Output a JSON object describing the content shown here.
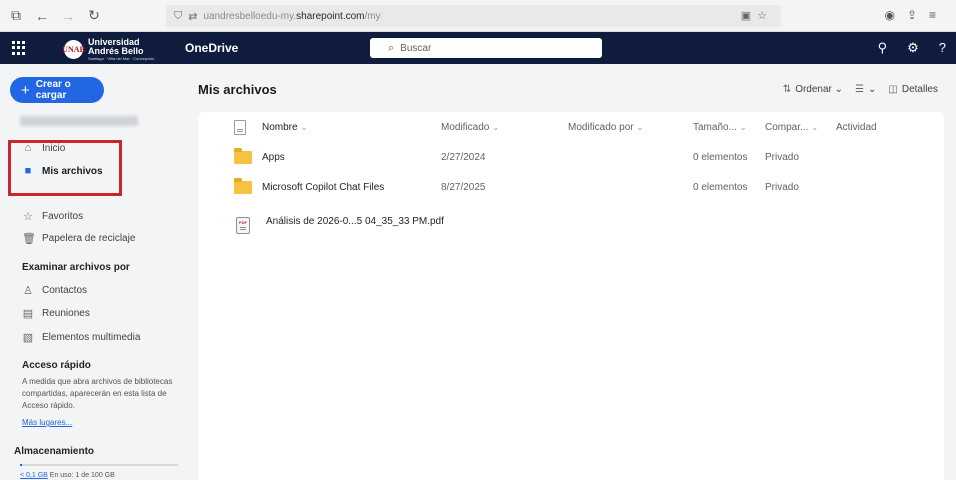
{
  "browser": {
    "nav_icons": [
      "tabs-icon",
      "back-icon",
      "forward-icon",
      "reload-icon"
    ],
    "url_prefix": "uandresbelloedu-my.",
    "url_host": "sharepoint.com",
    "url_path": "/my"
  },
  "header": {
    "logo_line1": "Universidad",
    "logo_line2": "Andrés Bello",
    "logo_tagline": "Santiago · Viña del Mar · Concepción",
    "app_name": "OneDrive",
    "search_placeholder": "Buscar"
  },
  "sidebar": {
    "create_label": "Crear o cargar",
    "items": [
      {
        "label": "Inicio",
        "icon": "home-icon"
      },
      {
        "label": "Mis archivos",
        "icon": "folder-icon",
        "active": true
      },
      {
        "label": "Favoritos",
        "icon": "star-icon"
      },
      {
        "label": "Papelera de reciclaje",
        "icon": "trash-icon"
      }
    ],
    "browse_heading": "Examinar archivos por",
    "browse_items": [
      {
        "label": "Contactos",
        "icon": "people-icon"
      },
      {
        "label": "Reuniones",
        "icon": "calendar-icon"
      },
      {
        "label": "Elementos multimedia",
        "icon": "image-icon"
      }
    ],
    "quick_access_heading": "Acceso rápido",
    "quick_access_text": "A medida que abra archivos de bibliotecas compartidas, aparecerán en esta lista de Acceso rápido.",
    "more_places": "Más lugares...",
    "storage_heading": "Almacenamiento",
    "storage_used_link": "< 0,1 GB",
    "storage_text": "En uso: 1 de 100 GB",
    "storage_fraction": 0.001
  },
  "main": {
    "title": "Mis archivos",
    "toolbar": {
      "sort": "Ordenar",
      "details": "Detalles"
    },
    "columns": {
      "name": "Nombre",
      "modified": "Modificado",
      "modified_by": "Modificado por",
      "size": "Tamaño...",
      "sharing": "Compar...",
      "activity": "Actividad"
    },
    "files": [
      {
        "name": "Apps",
        "type": "folder",
        "modified": "2/27/2024",
        "size": "0 elementos",
        "sharing": "Privado"
      },
      {
        "name": "Microsoft Copilot Chat Files",
        "type": "folder",
        "modified": "8/27/2025",
        "size": "0 elementos",
        "sharing": "Privado"
      },
      {
        "name": "Análisis de 2026-0...5 04_35_33 PM.pdf",
        "type": "pdf",
        "pdf_badge": "PDF",
        "modified": "",
        "size": "",
        "sharing": ""
      }
    ]
  }
}
